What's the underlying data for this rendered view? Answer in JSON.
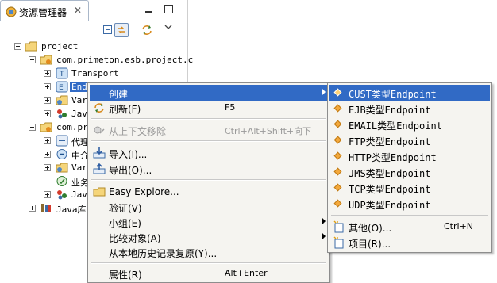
{
  "view": {
    "tab_title": "资源管理器",
    "tab_close": "✕"
  },
  "tree": [
    {
      "label": "project"
    },
    {
      "label": "com.primeton.esb.project.c"
    },
    {
      "label": "Transport"
    },
    {
      "label": "Endp"
    },
    {
      "label": "Var"
    },
    {
      "label": "Jav"
    },
    {
      "label": "com.pri"
    },
    {
      "label": "代理"
    },
    {
      "label": "中介"
    },
    {
      "label": "Var"
    },
    {
      "label": "业务"
    },
    {
      "label": "Jav"
    },
    {
      "label": "Java库"
    }
  ],
  "context_menu": {
    "items": [
      {
        "label": "创建",
        "accel": ""
      },
      {
        "label": "刷新(F)",
        "accel": "F5"
      },
      {
        "label": "从上下文移除",
        "accel": "Ctrl+Alt+Shift+向下"
      },
      {
        "label": "导入(I)...",
        "accel": ""
      },
      {
        "label": "导出(O)...",
        "accel": ""
      },
      {
        "label": "Easy Explore...",
        "accel": ""
      },
      {
        "label": "验证(V)",
        "accel": ""
      },
      {
        "label": "小组(E)",
        "accel": ""
      },
      {
        "label": "比较对象(A)",
        "accel": ""
      },
      {
        "label": "从本地历史记录复原(Y)...",
        "accel": ""
      },
      {
        "label": "属性(R)",
        "accel": "Alt+Enter"
      }
    ]
  },
  "submenu": {
    "items": [
      {
        "label": "CUST类型Endpoint"
      },
      {
        "label": "EJB类型Endpoint"
      },
      {
        "label": "EMAIL类型Endpoint"
      },
      {
        "label": "FTP类型Endpoint"
      },
      {
        "label": "HTTP类型Endpoint"
      },
      {
        "label": "JMS类型Endpoint"
      },
      {
        "label": "TCP类型Endpoint"
      },
      {
        "label": "UDP类型Endpoint"
      },
      {
        "label": "其他(O)...",
        "accel": "Ctrl+N"
      },
      {
        "label": "项目(R)..."
      }
    ]
  },
  "colors": {
    "selection": "#316ac5",
    "menu_bg": "#f5f4f0",
    "diamond": "#f3a83b"
  }
}
